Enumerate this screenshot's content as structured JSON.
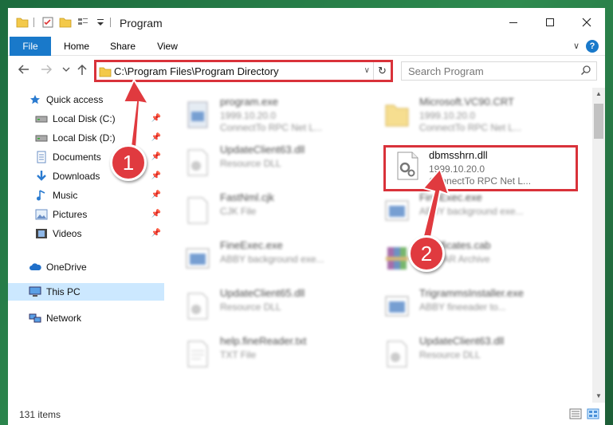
{
  "window": {
    "title": "Program"
  },
  "ribbon": {
    "tabs": [
      {
        "label": "File"
      },
      {
        "label": "Home"
      },
      {
        "label": "Share"
      },
      {
        "label": "View"
      }
    ],
    "help": "?"
  },
  "nav": {
    "address_path": "C:\\Program Files\\Program Directory",
    "search_placeholder": "Search Program"
  },
  "sidebar": {
    "items": [
      {
        "label": "Quick access",
        "icon": "star-icon"
      },
      {
        "label": "Local Disk (C:)",
        "icon": "drive-icon"
      },
      {
        "label": "Local Disk (D:)",
        "icon": "drive-icon"
      },
      {
        "label": "Documents",
        "icon": "documents-icon"
      },
      {
        "label": "Downloads",
        "icon": "download-icon"
      },
      {
        "label": "Music",
        "icon": "music-icon"
      },
      {
        "label": "Pictures",
        "icon": "pictures-icon"
      },
      {
        "label": "Videos",
        "icon": "videos-icon"
      },
      {
        "label": "OneDrive",
        "icon": "cloud-icon"
      },
      {
        "label": "This PC",
        "icon": "computer-icon"
      },
      {
        "label": "Network",
        "icon": "network-icon"
      }
    ]
  },
  "files": [
    {
      "name": "program.exe",
      "meta1": "1999.10.20.0",
      "meta2": "ConnectTo RPC Net L...",
      "icon": "exe-icon"
    },
    {
      "name": "Microsoft.VC90.CRT",
      "meta1": "1999.10.20.0",
      "meta2": "ConnectTo RPC Net L...",
      "icon": "folder-icon"
    },
    {
      "name": "UpdateClient63.dll",
      "meta1": "Resource DLL",
      "meta2": "",
      "icon": "dll-icon"
    },
    {
      "name": "dbmsshrn.dll",
      "meta1": "1999.10.20.0",
      "meta2": "ConnectTo RPC Net L...",
      "icon": "dll-icon"
    },
    {
      "name": "FastNml.cjk",
      "meta1": "CJK File",
      "meta2": "",
      "icon": "file-icon"
    },
    {
      "name": "FineExec.exe",
      "meta1": "ABBY background exe...",
      "meta2": "",
      "icon": "app-icon"
    },
    {
      "name": "FineExec.exe",
      "meta1": "ABBY background exe...",
      "meta2": "",
      "icon": "app-icon"
    },
    {
      "name": "Certificates.cab",
      "meta1": "WinRAR Archive",
      "meta2": "",
      "icon": "archive-icon"
    },
    {
      "name": "UpdateClient65.dll",
      "meta1": "Resource DLL",
      "meta2": "",
      "icon": "dll-icon"
    },
    {
      "name": "TrigrammsInstaller.exe",
      "meta1": "ABBY fineeader to...",
      "meta2": "",
      "icon": "app-icon"
    },
    {
      "name": "help.fineReader.txt",
      "meta1": "TXT File",
      "meta2": "",
      "icon": "text-file-icon"
    },
    {
      "name": "UpdateClient63.dll",
      "meta1": "Resource DLL",
      "meta2": "",
      "icon": "dll-icon"
    }
  ],
  "status": {
    "count": "131 items"
  },
  "callouts": {
    "one": "1",
    "two": "2"
  },
  "colors": {
    "accent": "#1979ca",
    "highlight": "#d9323a",
    "selected": "#cce8ff"
  }
}
